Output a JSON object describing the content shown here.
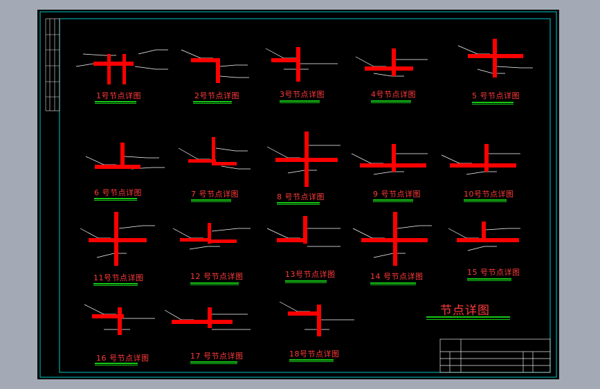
{
  "drawing_title": "节点详图",
  "nodes": [
    {
      "label": "1号节点详图"
    },
    {
      "label": "2号节点详图"
    },
    {
      "label": "3号节点详图"
    },
    {
      "label": "4号节点详图"
    },
    {
      "label": "5 号节点详图"
    },
    {
      "label": "6 号节点详图"
    },
    {
      "label": "7 号节点详图"
    },
    {
      "label": "8 号节点详图"
    },
    {
      "label": "9 号节点详图"
    },
    {
      "label": "10号节点详图"
    },
    {
      "label": "11号节点详图"
    },
    {
      "label": "12 号节点详图"
    },
    {
      "label": "13号节点详图"
    },
    {
      "label": "14 号节点详图"
    },
    {
      "label": "15 号节点详图"
    },
    {
      "label": "16 号节点详图"
    },
    {
      "label": "17 号节点详图"
    },
    {
      "label": "18号节点详图"
    }
  ],
  "colors": {
    "pipe": "#ff0000",
    "annotation": "#ff3b3b",
    "leader": "#ffffff",
    "underline": "#15c915",
    "frame": "#00c8c8",
    "background": "#000000",
    "workspace": "#a3aab5"
  }
}
